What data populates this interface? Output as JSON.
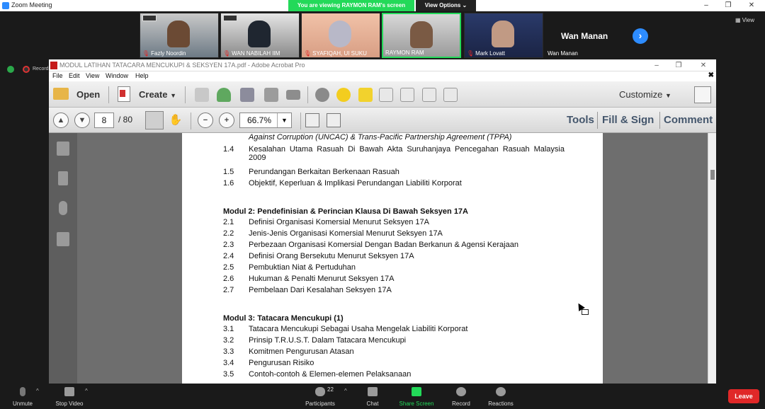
{
  "zoom": {
    "title": "Zoom Meeting",
    "viewing_banner": "You are viewing RAYMON RAM's screen",
    "view_options": "View Options",
    "view_button": "View",
    "recording_label": "Recording..."
  },
  "participants": [
    {
      "name": "Fazly Noordin",
      "muted": true
    },
    {
      "name": "WAN NABILAH IIM",
      "muted": true
    },
    {
      "name": "SYAFIQAH, UI SUKU",
      "muted": true
    },
    {
      "name": "RAYMON RAM",
      "muted": false,
      "active": true
    },
    {
      "name": "Mark Lovatt",
      "muted": true
    },
    {
      "name": "Wan Manan",
      "muted": false,
      "name_only": true
    }
  ],
  "acrobat": {
    "window_title": "MODUL LATIHAN TATACARA MENCUKUPI & SEKSYEN 17A.pdf - Adobe Acrobat Pro",
    "menu": [
      "File",
      "Edit",
      "View",
      "Window",
      "Help"
    ],
    "toolbar": {
      "open": "Open",
      "create": "Create",
      "customize": "Customize"
    },
    "nav": {
      "page_current": "8",
      "page_total": "/ 80",
      "zoom": "66.7%"
    },
    "tabs": [
      "Tools",
      "Fill & Sign",
      "Comment"
    ]
  },
  "document": {
    "lines": [
      {
        "num": "",
        "text": "Against Corruption (UNCAC) & Trans-Pacific Partnership Agreement (TPPA)",
        "style": "ital"
      },
      {
        "num": "1.4",
        "text": "Kesalahan Utama Rasuah Di Bawah Akta Suruhanjaya Pencegahan Rasuah Malaysia 2009"
      },
      {
        "num": "1.5",
        "text": "Perundangan Berkaitan Berkenaan Rasuah"
      },
      {
        "num": "1.6",
        "text": "Objektif, Keperluan & Implikasi Perundangan Liabiliti Korporat"
      },
      {
        "num": "",
        "text": "Modul 2: Pendefinisian & Perincian Klausa Di Bawah Seksyen 17A",
        "style": "head"
      },
      {
        "num": "2.1",
        "text": "Definisi Organisasi Komersial Menurut Seksyen 17A"
      },
      {
        "num": "2.2",
        "text": "Jenis-Jenis Organisasi Komersial Menurut Seksyen 17A"
      },
      {
        "num": "2.3",
        "text": "Perbezaan Organisasi Komersial Dengan Badan Berkanun & Agensi Kerajaan"
      },
      {
        "num": "2.4",
        "text": "Definisi Orang Bersekutu Menurut Seksyen 17A"
      },
      {
        "num": "2.5",
        "text": "Pembuktian Niat & Pertuduhan"
      },
      {
        "num": "2.6",
        "text": "Hukuman & Penalti Menurut Seksyen 17A"
      },
      {
        "num": "2.7",
        "text": "Pembelaan Dari Kesalahan Seksyen 17A"
      },
      {
        "num": "",
        "text": "Modul 3: Tatacara Mencukupi (1)",
        "style": "head"
      },
      {
        "num": "3.1",
        "text": "Tatacara Mencukupi Sebagai Usaha Mengelak Liabiliti Korporat"
      },
      {
        "num": "3.2",
        "text": "Prinsip T.R.U.S.T. Dalam Tatacara Mencukupi"
      },
      {
        "num": "3.3",
        "text": "Komitmen Pengurusan Atasan"
      },
      {
        "num": "3.4",
        "text": "Pengurusan Risiko"
      },
      {
        "num": "3.5",
        "text": "Contoh-contoh & Elemen-elemen Pelaksanaan"
      }
    ]
  },
  "bottombar": {
    "unmute": "Unmute",
    "stop_video": "Stop Video",
    "participants": "Participants",
    "participant_count": "22",
    "chat": "Chat",
    "share_screen": "Share Screen",
    "record": "Record",
    "reactions": "Reactions",
    "leave": "Leave"
  }
}
